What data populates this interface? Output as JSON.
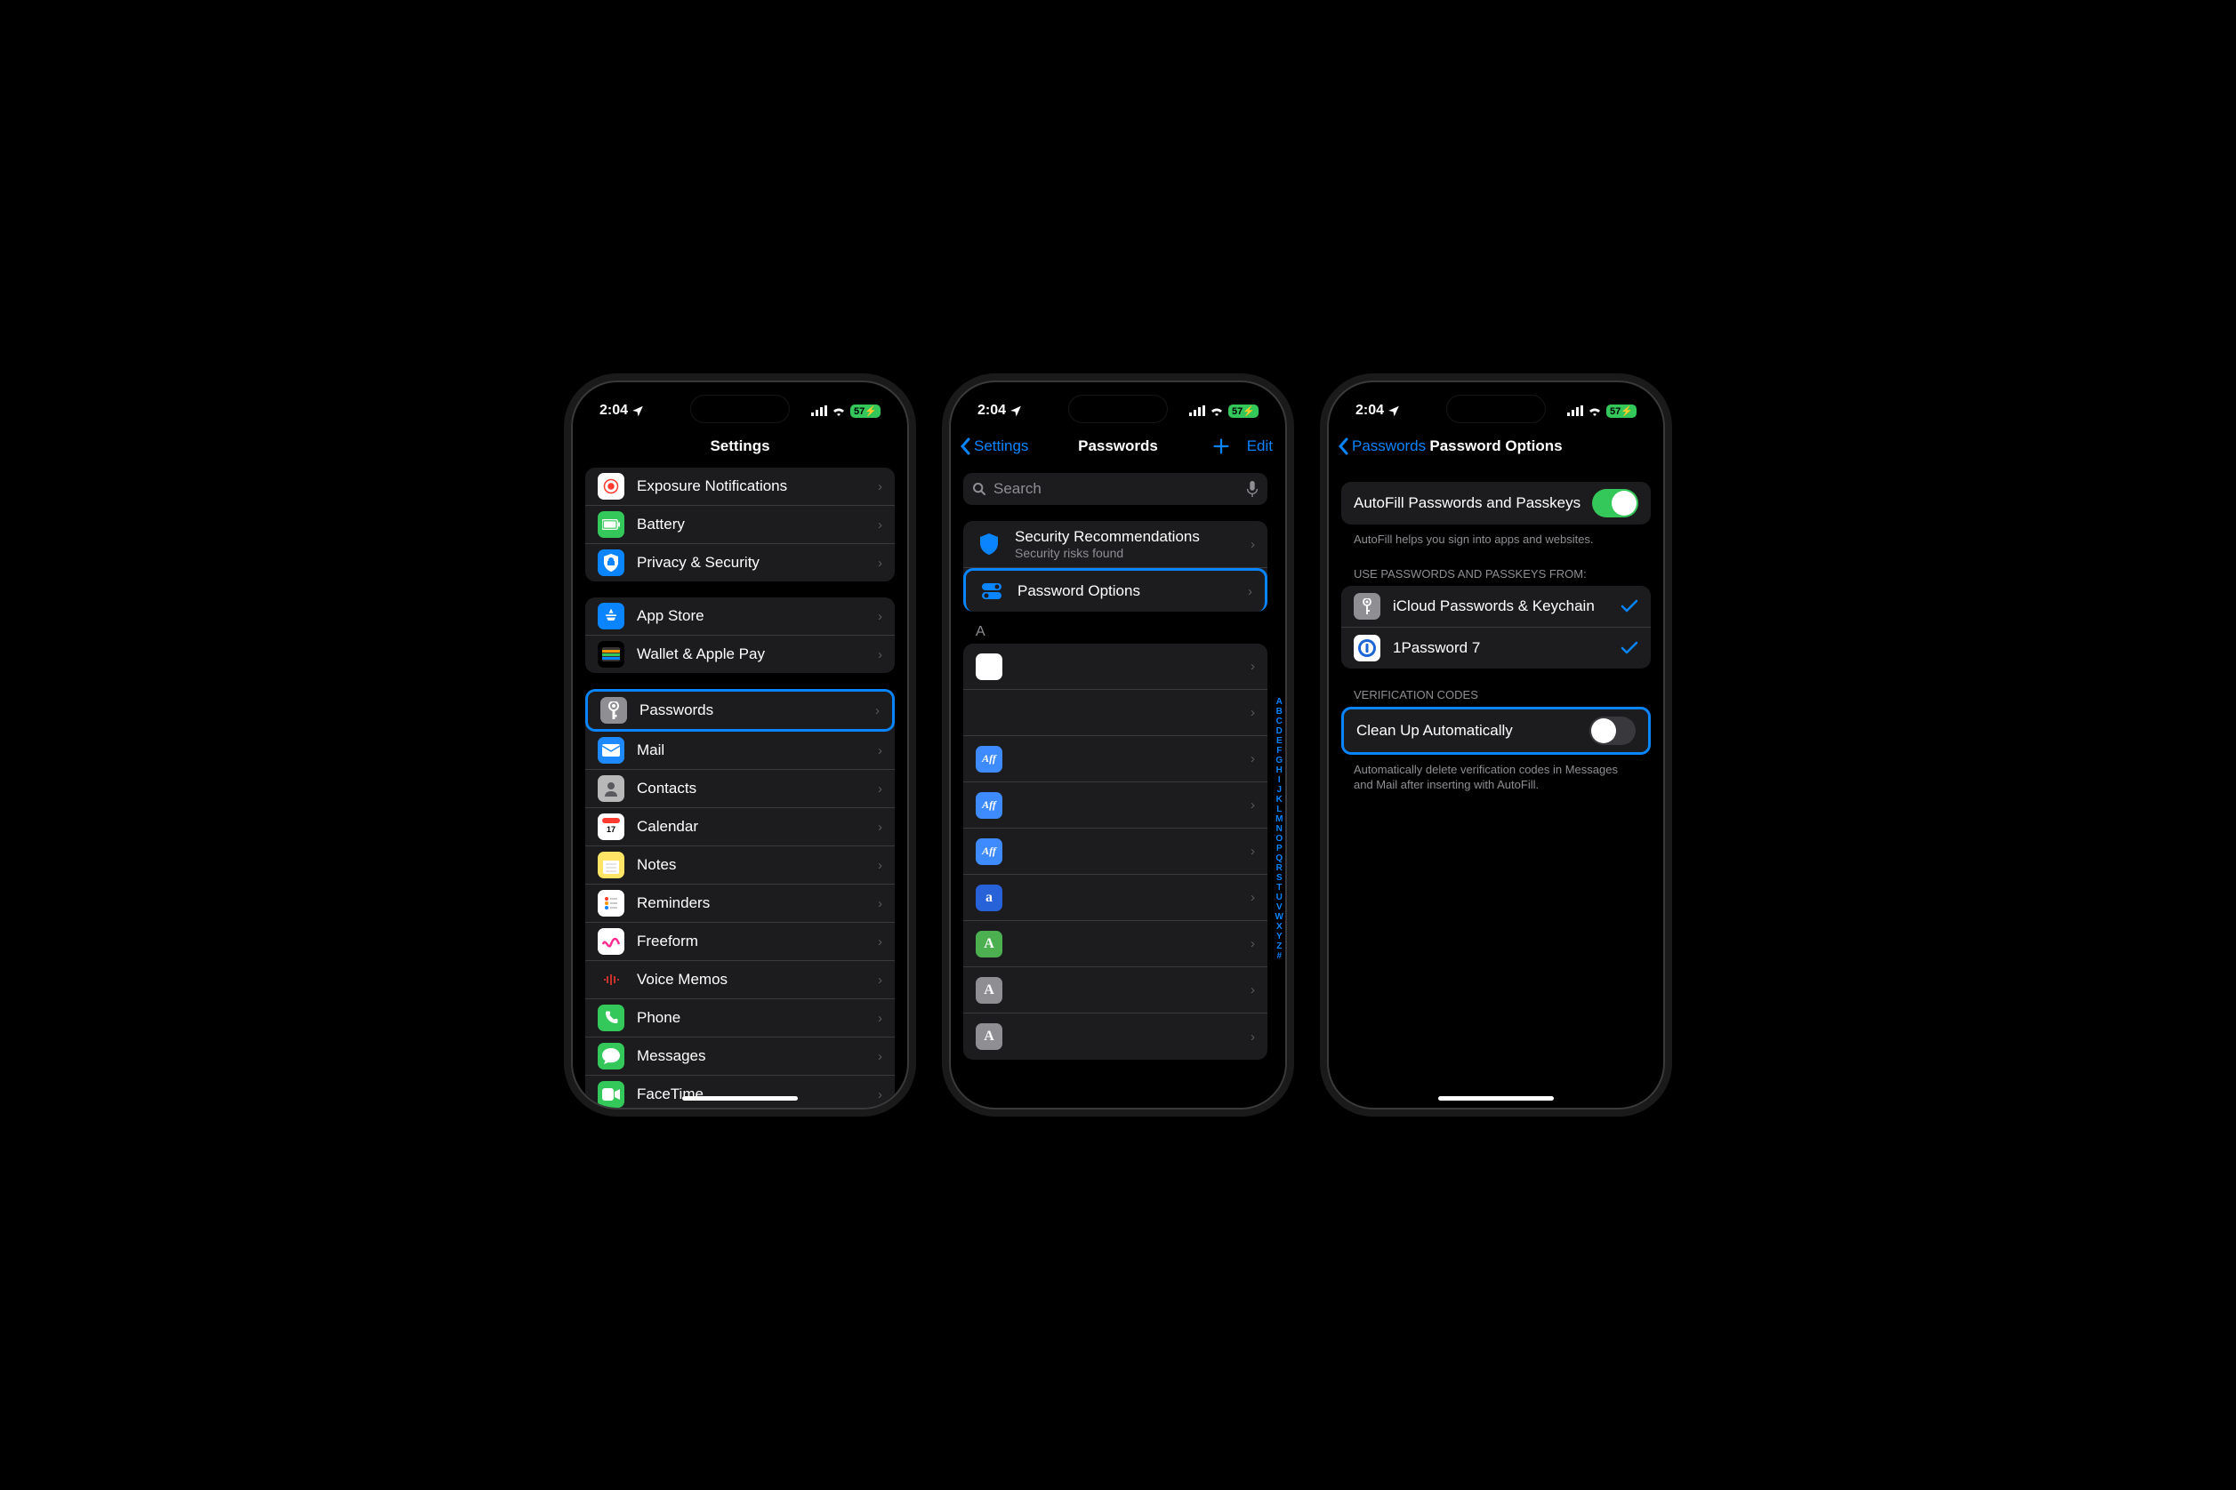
{
  "status": {
    "time": "2:04",
    "battery": "57"
  },
  "alphabet": [
    "A",
    "B",
    "C",
    "D",
    "E",
    "F",
    "G",
    "H",
    "I",
    "J",
    "K",
    "L",
    "M",
    "N",
    "O",
    "P",
    "Q",
    "R",
    "S",
    "T",
    "U",
    "V",
    "W",
    "X",
    "Y",
    "Z",
    "#"
  ],
  "s1": {
    "title": "Settings",
    "g1": [
      {
        "label": "Exposure Notifications",
        "name": "exposure-notifications",
        "bg": "#ffffff"
      },
      {
        "label": "Battery",
        "name": "battery",
        "bg": "#34c759"
      },
      {
        "label": "Privacy & Security",
        "name": "privacy-security",
        "bg": "#0a84ff"
      }
    ],
    "g2": [
      {
        "label": "App Store",
        "name": "app-store",
        "bg": "#0a84ff"
      },
      {
        "label": "Wallet & Apple Pay",
        "name": "wallet-apple-pay",
        "bg": "#000"
      }
    ],
    "g3": [
      {
        "label": "Passwords",
        "name": "passwords",
        "bg": "#8e8e93",
        "hl": true
      },
      {
        "label": "Mail",
        "name": "mail",
        "bg": "#1e88ff"
      },
      {
        "label": "Contacts",
        "name": "contacts",
        "bg": "#b8b8b8"
      },
      {
        "label": "Calendar",
        "name": "calendar",
        "bg": "#ffffff"
      },
      {
        "label": "Notes",
        "name": "notes",
        "bg": "#ffe465"
      },
      {
        "label": "Reminders",
        "name": "reminders",
        "bg": "#ffffff"
      },
      {
        "label": "Freeform",
        "name": "freeform",
        "bg": "#ffffff"
      },
      {
        "label": "Voice Memos",
        "name": "voice-memos",
        "bg": "#1c1c1e"
      },
      {
        "label": "Phone",
        "name": "phone",
        "bg": "#34c759"
      },
      {
        "label": "Messages",
        "name": "messages",
        "bg": "#34c759"
      },
      {
        "label": "FaceTime",
        "name": "facetime",
        "bg": "#34c759"
      }
    ]
  },
  "s2": {
    "back": "Settings",
    "title": "Passwords",
    "edit": "Edit",
    "search_ph": "Search",
    "rec": {
      "title": "Security Recommendations",
      "sub": "Security risks found"
    },
    "opt": "Password Options",
    "section_letter": "A",
    "rows": [
      {
        "bg": "#ffffff",
        "t": ""
      },
      {
        "bg": "#1c1c1e",
        "t": ""
      },
      {
        "bg": "#3d8bff",
        "t": "Aff"
      },
      {
        "bg": "#3d8bff",
        "t": "Aff"
      },
      {
        "bg": "#3d8bff",
        "t": "Aff"
      },
      {
        "bg": "#2862d9",
        "t": "a"
      },
      {
        "bg": "#4caf50",
        "t": "A"
      },
      {
        "bg": "#8e8e93",
        "t": "A"
      },
      {
        "bg": "#8e8e93",
        "t": "A"
      }
    ]
  },
  "s3": {
    "back": "Passwords",
    "title": "Password Options",
    "autofill_label": "AutoFill Passwords and Passkeys",
    "autofill_on": true,
    "autofill_foot": "AutoFill helps you sign into apps and websites.",
    "use_header": "USE PASSWORDS AND PASSKEYS FROM:",
    "providers": [
      {
        "label": "iCloud Passwords & Keychain",
        "name": "icloud-keychain",
        "bg": "#8e8e93"
      },
      {
        "label": "1Password 7",
        "name": "1password",
        "bg": "#ffffff"
      }
    ],
    "verif_header": "VERIFICATION CODES",
    "cleanup_label": "Clean Up Automatically",
    "cleanup_on": false,
    "cleanup_foot": "Automatically delete verification codes in Messages and Mail after inserting with AutoFill."
  }
}
